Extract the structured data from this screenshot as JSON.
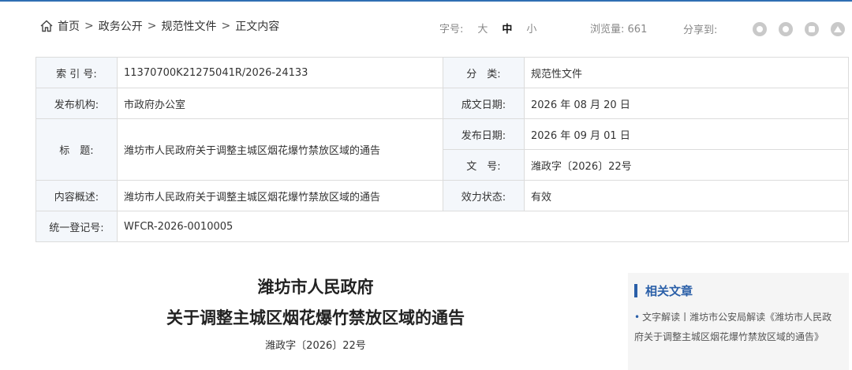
{
  "breadcrumb": {
    "items": [
      "首页",
      "政务公开",
      "规范性文件",
      "正文内容"
    ],
    "separator": ">"
  },
  "toolbar": {
    "font_size_label": "字号:",
    "font_large": "大",
    "font_medium": "中",
    "font_small": "小",
    "views_label": "浏览量:",
    "views_count": "661",
    "share_label": "分享到:"
  },
  "meta": {
    "index_label": "索 引 号:",
    "index_value": "11370700K21275041R/2026-24133",
    "category_label": "分　类:",
    "category_value": "规范性文件",
    "issuer_label": "发布机构:",
    "issuer_value": "市政府办公室",
    "written_date_label": "成文日期:",
    "written_date_value": "2026 年 08 月 20 日",
    "title_label": "标　题:",
    "title_value": "潍坊市人民政府关于调整主城区烟花爆竹禁放区域的通告",
    "publish_date_label": "发布日期:",
    "publish_date_value": "2026 年 09 月 01 日",
    "doc_number_label": "文　号:",
    "doc_number_value": "潍政字〔2026〕22号",
    "summary_label": "内容概述:",
    "summary_value": "潍坊市人民政府关于调整主城区烟花爆竹禁放区域的通告",
    "status_label": "效力状态:",
    "status_value": "有效",
    "reg_label": "统一登记号:",
    "reg_value": "WFCR-2026-0010005"
  },
  "article": {
    "title_line1": "潍坊市人民政府",
    "title_line2": "关于调整主城区烟花爆竹禁放区域的通告",
    "doc_number": "潍政字〔2026〕22号"
  },
  "related": {
    "heading": "相关文章",
    "items": [
      {
        "text": "文字解读丨潍坊市公安局解读《潍坊市人民政府关于调整主城区烟花爆竹禁放区域的通告》"
      }
    ]
  },
  "colors": {
    "accent": "#2a5fa8",
    "label_bg": "#f4f7fb",
    "border": "#dcdcdc"
  },
  "icons": [
    "home-icon",
    "wechat-icon",
    "weibo-icon",
    "qzone-icon",
    "favorite-icon"
  ]
}
